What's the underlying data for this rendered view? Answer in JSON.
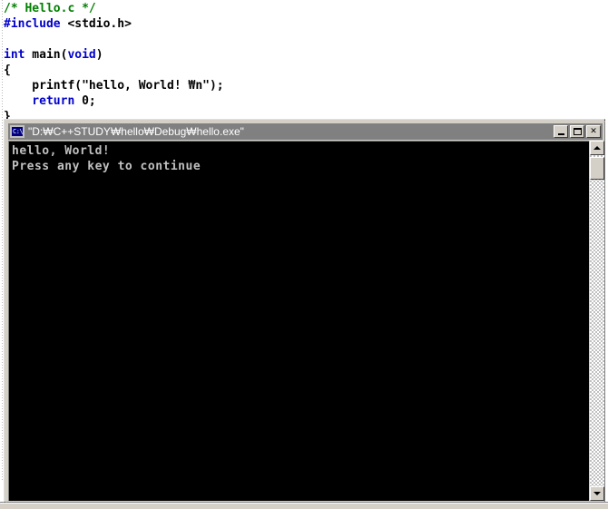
{
  "editor": {
    "name": "source-code-editor",
    "background_color": "#ffffff",
    "code_lines": [
      {
        "text": "/* Hello.c */",
        "type": "comment"
      },
      {
        "text": "#include <stdio.h>",
        "type": "preprocessor"
      },
      {
        "text": "",
        "type": "blank"
      },
      {
        "text": "int main(void)",
        "type": "code"
      },
      {
        "text": "{",
        "type": "code"
      },
      {
        "text": "    printf(\"hello, World! ₩n\");",
        "type": "code"
      },
      {
        "text": "    return 0;",
        "type": "code"
      },
      {
        "text": "}",
        "type": "code"
      }
    ],
    "tokens": {
      "comment": "/* Hello.c */",
      "include_directive": "#include",
      "include_header": " <stdio.h>",
      "kw_int": "int",
      "fn_main": " main(",
      "kw_void": "void",
      "paren_close": ")",
      "brace_open": "{",
      "printf_line": "    printf(\"hello, World! ₩n\");",
      "kw_return": "    return",
      "return_value": " 0;",
      "brace_close": "}"
    },
    "colors": {
      "comment": "#008000",
      "keyword": "#0000cc",
      "preprocessor": "#0000cc",
      "plain": "#000000"
    }
  },
  "console_window": {
    "name": "console-output-window",
    "title": "\"D:₩C++STUDY₩hello₩Debug₩hello.exe\"",
    "icon": "ms-dos-console-icon",
    "icon_text": "C:\\",
    "titlebar_color": "#808080",
    "titlebar_text_color": "#ffffff",
    "active": false,
    "buttons": {
      "minimize": "_",
      "maximize": "□",
      "close": "✕"
    },
    "client": {
      "background_color": "#000000",
      "text_color": "#c0c0c0",
      "lines": [
        "hello, World!",
        "Press any key to continue"
      ]
    },
    "scrollbar": {
      "orientation": "vertical",
      "up_arrow": "▲",
      "down_arrow": "▼",
      "thumb_position_percent": 0
    }
  }
}
